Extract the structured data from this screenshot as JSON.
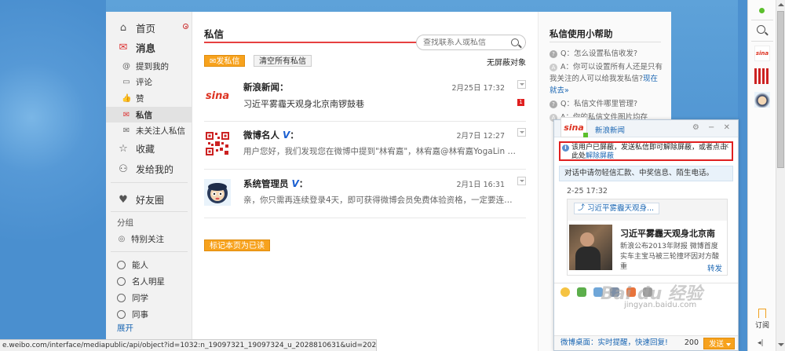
{
  "nav": {
    "home": "首页",
    "messages": "消息",
    "mentions": "提到我的",
    "comments": "评论",
    "likes": "赞",
    "private_msg": "私信",
    "unfollowed_msg": "未关注人私信",
    "favorites": "收藏",
    "from_me": "发给我的",
    "friends": "好友圈",
    "group_label": "分组",
    "special": "特别关注",
    "groups": [
      "能人",
      "名人明星",
      "同学",
      "同事"
    ],
    "expand": "展开"
  },
  "main": {
    "title": "私信",
    "search_placeholder": "查找联系人或私信",
    "send_btn": "发私信",
    "clear_btn": "清空所有私信",
    "unblock": "无屏蔽对象",
    "mark_read_btn": "标记本页为已读",
    "messages": [
      {
        "name": "新浪新闻",
        "suffix": "：",
        "time": "2月25日 17:32",
        "text": "习近平雾霾天观身北京南锣鼓巷",
        "unread": "1",
        "avatar_label": "sina"
      },
      {
        "name": "微博名人",
        "suffix": "：",
        "verified": "V",
        "time": "2月7日 12:27",
        "text": "用户您好，我们发现您在微博中提到\"林宥嘉\"，林宥嘉@林宥嘉YogaLin …"
      },
      {
        "name": "系统管理员",
        "suffix": "：",
        "verified": "V",
        "time": "2月1日 16:31",
        "text": "亲，你只需再连续登录4天，即可获得微博会员免费体验资格，一定要连…"
      }
    ]
  },
  "help": {
    "title": "私信使用小帮助",
    "q1": "Q：怎么设置私信收发?",
    "a1": "A：你可以设置所有人还是只有我关注的人可以给我发私信?",
    "a1_link": "现在就去»",
    "q2": "Q：私信文件哪里管理?",
    "a2": "A：你的私信文件图片均存"
  },
  "chat": {
    "title": "新浪新闻",
    "logo_text": "sina",
    "controls": "⚙ − ✕",
    "warning": "该用户已屏蔽，发送私信即可解除屏蔽，或者点击此处",
    "warning_link": "解除屏蔽",
    "notice": "对话中请勿轻信汇款、中奖信息、陌生电话。",
    "time": "2-25 17:32",
    "card_link": "习近平雾霾天观身...",
    "card_title": "习近平雾霾天观身北京南",
    "card_desc": "新浪公布2013年财报 微博首度实车主宝马被三轮撞坏因对方酸重",
    "card_share": "转发",
    "footer_text": "微博桌面：实时提醒，快速回复!",
    "count": "200",
    "send": "发送"
  },
  "watermark": {
    "logo": "Bai du 经验",
    "url": "jingyan.baidu.com"
  },
  "statusbar": "e.weibo.com/interface/mediapublic/api/object?id=1032:n_19097321_19097324_u_2028810631&uid=2028810631",
  "rightbar": {
    "subscribe": "订阅",
    "collapse": "◂|"
  },
  "colors": {
    "accent_orange": "#f7a21d",
    "title_red": "#e64141",
    "link_blue": "#1a66b3",
    "verified_blue": "#1a5fd1"
  }
}
